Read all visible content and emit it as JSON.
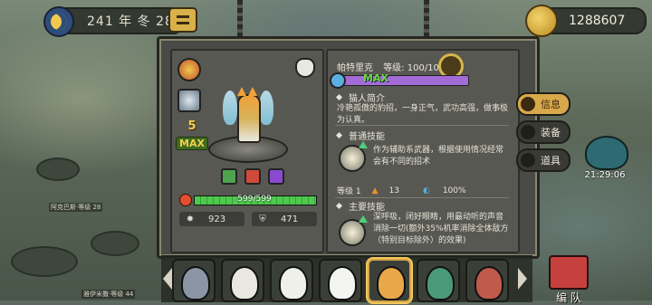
{
  "topbar": {
    "date": "241 年 冬 28",
    "coins": "1288607"
  },
  "hero": {
    "name": "帕特里克",
    "level_label": "等级: 100/100",
    "star_level": "5",
    "max_badge": "MAX",
    "max_bar_label": "MAX",
    "hp_text": "599/599",
    "hp_fraction": 1.0,
    "attack": "923",
    "defense": "471"
  },
  "intro": {
    "title": "猫人简介",
    "text": "冷艳孤傲的豹招，一身正气，武功高强，做事极为认真。"
  },
  "normal_skill": {
    "title": "普通技能",
    "text": "作为辅助系武器，根据使用情况经常会有不同的招术",
    "level_label": "等级 1",
    "value1": "13",
    "value2": "100%"
  },
  "main_skill": {
    "title": "主要技能",
    "text": "深呼吸，闭好眼睛，用最动听的声音消除一切(额外35%机率消除全体敌方（特别目标除外）的效果)"
  },
  "side_tabs": [
    {
      "label": "信息",
      "active": true
    },
    {
      "label": "装备",
      "active": false
    },
    {
      "label": "道具",
      "active": false
    }
  ],
  "timer": "21:29:06",
  "team_button": "编 队",
  "tags": [
    "阿克巴斯·等级 28",
    "雅伊米撒·等级 44"
  ],
  "colors": {
    "accent": "#d8a84a",
    "hp": "#4ec94e",
    "max_bar": "#a36bd8",
    "panel": "#585853"
  }
}
